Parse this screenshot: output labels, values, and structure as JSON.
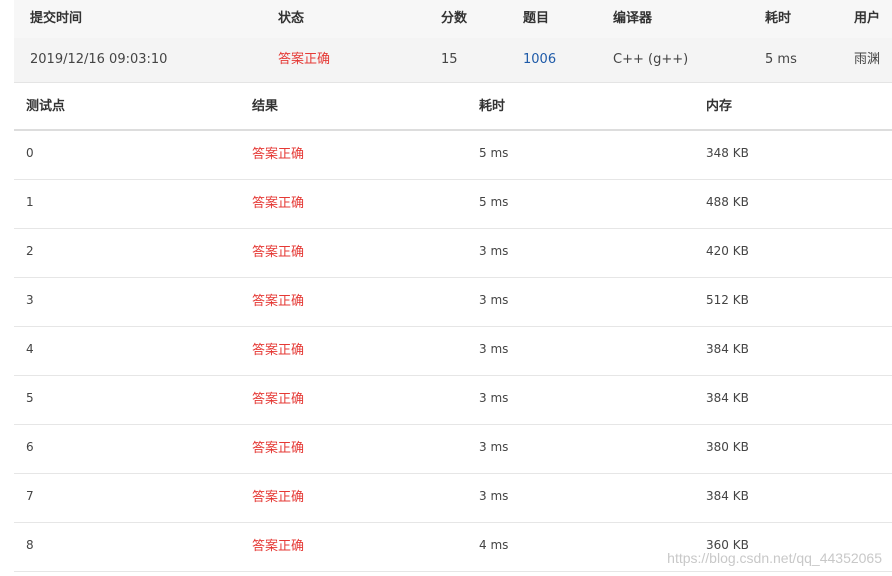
{
  "submission": {
    "headers": {
      "time": "提交时间",
      "status": "状态",
      "score": "分数",
      "problem": "题目",
      "compiler": "编译器",
      "elapsed": "耗时",
      "user": "用户"
    },
    "row": {
      "time": "2019/12/16 09:03:10",
      "status": "答案正确",
      "score": "15",
      "problem": "1006",
      "compiler": "C++ (g++)",
      "elapsed": "5 ms",
      "user": "雨渊"
    }
  },
  "testcases": {
    "headers": {
      "case": "测试点",
      "result": "结果",
      "elapsed": "耗时",
      "memory": "内存"
    },
    "rows": [
      {
        "case": "0",
        "result": "答案正确",
        "elapsed": "5 ms",
        "memory": "348 KB"
      },
      {
        "case": "1",
        "result": "答案正确",
        "elapsed": "5 ms",
        "memory": "488 KB"
      },
      {
        "case": "2",
        "result": "答案正确",
        "elapsed": "3 ms",
        "memory": "420 KB"
      },
      {
        "case": "3",
        "result": "答案正确",
        "elapsed": "3 ms",
        "memory": "512 KB"
      },
      {
        "case": "4",
        "result": "答案正确",
        "elapsed": "3 ms",
        "memory": "384 KB"
      },
      {
        "case": "5",
        "result": "答案正确",
        "elapsed": "3 ms",
        "memory": "384 KB"
      },
      {
        "case": "6",
        "result": "答案正确",
        "elapsed": "3 ms",
        "memory": "380 KB"
      },
      {
        "case": "7",
        "result": "答案正确",
        "elapsed": "3 ms",
        "memory": "384 KB"
      },
      {
        "case": "8",
        "result": "答案正确",
        "elapsed": "4 ms",
        "memory": "360 KB"
      }
    ]
  },
  "watermark": "https://blog.csdn.net/qq_44352065",
  "colors": {
    "accepted": "#e53935",
    "link": "#1e5aa8"
  }
}
